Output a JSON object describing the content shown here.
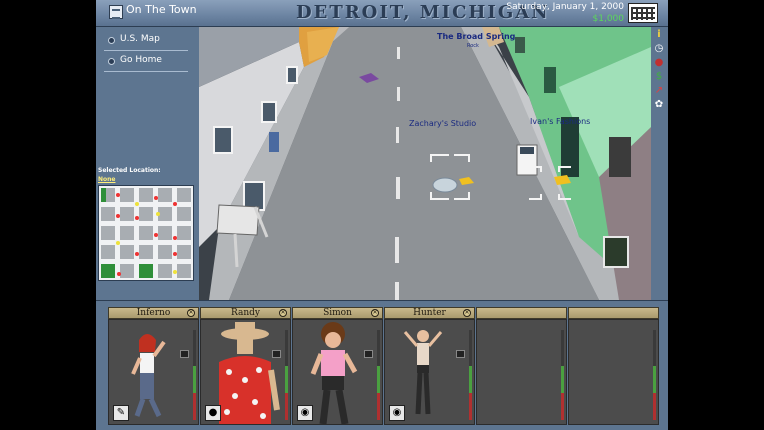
{
  "topbar": {
    "title": "On The Town",
    "city": "DETROIT, MICHIGAN",
    "date": "Saturday, January 1, 2000",
    "money": "$1,000"
  },
  "nav": {
    "items": [
      {
        "label": "U.S. Map"
      },
      {
        "label": "Go Home"
      }
    ]
  },
  "selected": {
    "label": "Selected Location:",
    "value": "None"
  },
  "scene": {
    "locations": [
      {
        "name": "The Broad Spring",
        "sub": "Rock"
      },
      {
        "name": "Zachary's Studio",
        "sub": ""
      },
      {
        "name": "Ivan's Fashions",
        "sub": ""
      }
    ]
  },
  "rightbar": {
    "icons": [
      "info-icon",
      "clock-icon",
      "record-icon",
      "money-icon",
      "chart-icon",
      "settings-icon"
    ]
  },
  "band": [
    {
      "name": "Inferno",
      "item": "guitar"
    },
    {
      "name": "Randy",
      "item": "mic"
    },
    {
      "name": "Simon",
      "item": "drum"
    },
    {
      "name": "Hunter",
      "item": "drum"
    },
    {
      "name": "",
      "item": ""
    },
    {
      "name": "",
      "item": ""
    }
  ]
}
